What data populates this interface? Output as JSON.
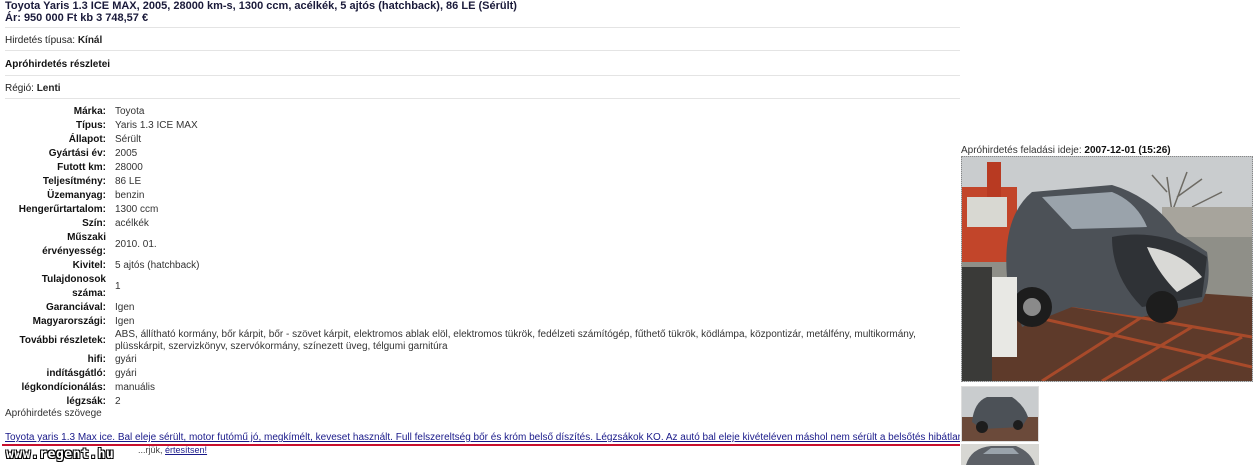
{
  "header": {
    "title": "Toyota Yaris 1.3 ICE MAX, 2005, 28000 km-s, 1300 ccm, acélkék, 5 ajtós (hatchback), 86 LE (Sérült)",
    "price": "Ár: 950 000 Ft kb 3 748,57 €"
  },
  "ad_type": {
    "label": "Hirdetés típusa:",
    "value": "Kínál"
  },
  "details_heading": "Apróhirdetés részletei",
  "region": {
    "label": "Régió:",
    "value": "Lenti"
  },
  "specs": [
    {
      "label": "Márka:",
      "value": "Toyota"
    },
    {
      "label": "Típus:",
      "value": "Yaris 1.3 ICE MAX"
    },
    {
      "label": "Állapot:",
      "value": "Sérült"
    },
    {
      "label": "Gyártási év:",
      "value": "2005"
    },
    {
      "label": "Futott km:",
      "value": "28000"
    },
    {
      "label": "Teljesítmény:",
      "value": "86 LE"
    },
    {
      "label": "Üzemanyag:",
      "value": "benzin"
    },
    {
      "label": "Hengerűrtartalom:",
      "value": "1300 ccm"
    },
    {
      "label": "Szín:",
      "value": "acélkék"
    },
    {
      "label": "Műszaki érvényesség:",
      "value": "2010. 01."
    },
    {
      "label": "Kivitel:",
      "value": "5 ajtós (hatchback)"
    },
    {
      "label": "Tulajdonosok száma:",
      "value": "1"
    },
    {
      "label": "Garanciával:",
      "value": "Igen"
    },
    {
      "label": "Magyarországi:",
      "value": "Igen"
    },
    {
      "label": "További részletek:",
      "value": "ABS, állítható kormány, bőr kárpit, bőr - szövet kárpit, elektromos ablak elöl, elektromos tükrök, fedélzeti számítógép, fűthető tükrök, ködlámpa, központizár, metálfény, multikormány, plüsskárpit, szervizkönyv, szervókormány, színezett üveg, télgumi garnitúra"
    },
    {
      "label": "hifi:",
      "value": "gyári"
    },
    {
      "label": "indításgátló:",
      "value": "gyári"
    },
    {
      "label": "légkondícionálás:",
      "value": "manuális"
    },
    {
      "label": "légzsák:",
      "value": "2"
    }
  ],
  "description_label": "Apróhirdetés szövege",
  "description": "Toyota yaris 1.3 Max ice. Bal eleje sérült, motor futómű jó, megkímélt, keveset használt. Full felszereltség bőr és króm belső díszítés. Légzsákok KO. Az autó bal eleje kivételéven máshol nem sérült a belsőtés hibátlan.",
  "footer": {
    "watermark": "www.regent.hu",
    "fragment": "...rjük,",
    "link": "értesítsen!"
  },
  "sidebar": {
    "published_label": "Apróhirdetés feladási ideje:",
    "published_value": "2007-12-01 (15:26)"
  }
}
